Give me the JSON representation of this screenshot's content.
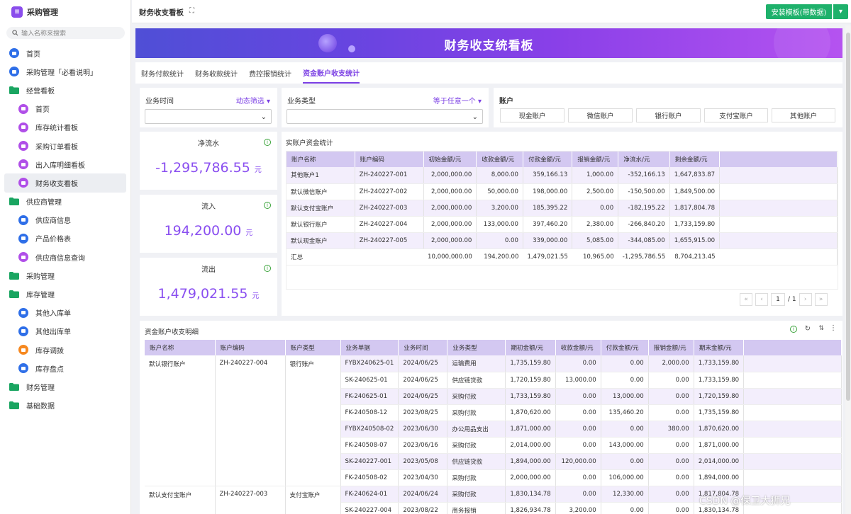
{
  "app": {
    "title": "采购管理"
  },
  "search": {
    "placeholder": "输入名称来搜索"
  },
  "nav": [
    {
      "label": "首页",
      "icon": "home-icon",
      "kind": "top"
    },
    {
      "label": "采购管理「必看说明」",
      "icon": "doc-icon",
      "kind": "top"
    },
    {
      "label": "经营看板",
      "icon": "folder-icon",
      "kind": "folder"
    },
    {
      "label": "首页",
      "icon": "dashboard-icon",
      "kind": "sub"
    },
    {
      "label": "库存统计看板",
      "icon": "dashboard-icon",
      "kind": "sub"
    },
    {
      "label": "采购订单看板",
      "icon": "dashboard-icon",
      "kind": "sub"
    },
    {
      "label": "出入库明细看板",
      "icon": "dashboard-icon",
      "kind": "sub"
    },
    {
      "label": "财务收支看板",
      "icon": "dashboard-icon",
      "kind": "sub",
      "active": true
    },
    {
      "label": "供应商管理",
      "icon": "folder-icon",
      "kind": "folder"
    },
    {
      "label": "供应商信息",
      "icon": "user-icon",
      "kind": "sub"
    },
    {
      "label": "产品价格表",
      "icon": "doc-icon",
      "kind": "sub"
    },
    {
      "label": "供应商信息查询",
      "icon": "dashboard-icon",
      "kind": "sub"
    },
    {
      "label": "采购管理",
      "icon": "folder-icon",
      "kind": "folder"
    },
    {
      "label": "库存管理",
      "icon": "folder-icon",
      "kind": "folder"
    },
    {
      "label": "其他入库单",
      "icon": "doc-icon",
      "kind": "sub"
    },
    {
      "label": "其他出库单",
      "icon": "doc-icon",
      "kind": "sub"
    },
    {
      "label": "库存调拨",
      "icon": "transfer-icon",
      "kind": "sub"
    },
    {
      "label": "库存盘点",
      "icon": "doc-icon",
      "kind": "sub"
    },
    {
      "label": "财务管理",
      "icon": "folder-icon",
      "kind": "folder"
    },
    {
      "label": "基础数据",
      "icon": "folder-icon",
      "kind": "folder"
    }
  ],
  "topbar": {
    "title": "财务收支看板",
    "install_label": "安装模板(带数据)"
  },
  "banner": {
    "title": "财务收支统看板"
  },
  "tabs": [
    "财务付款统计",
    "财务收款统计",
    "费控报销统计",
    "资金账户收支统计"
  ],
  "filters": {
    "time_label": "业务时间",
    "time_mode": "动态筛选",
    "type_label": "业务类型",
    "type_mode": "等于任意一个",
    "account_label": "账户",
    "account_buttons": [
      "现金账户",
      "微信账户",
      "银行账户",
      "支付宝账户",
      "其他账户"
    ]
  },
  "stats": [
    {
      "label": "净流水",
      "value": "-1,295,786.55",
      "unit": "元"
    },
    {
      "label": "流入",
      "value": "194,200.00",
      "unit": "元"
    },
    {
      "label": "流出",
      "value": "1,479,021.55",
      "unit": "元"
    }
  ],
  "summary": {
    "title": "实账户资金统计",
    "headers": [
      "账户名称",
      "账户编码",
      "初始金额/元",
      "收款金额/元",
      "付款金额/元",
      "报销金额/元",
      "净流水/元",
      "剩余金额/元"
    ],
    "rows": [
      [
        "其他账户1",
        "ZH-240227-001",
        "2,000,000.00",
        "8,000.00",
        "359,166.13",
        "1,000.00",
        "-352,166.13",
        "1,647,833.87"
      ],
      [
        "默认微信账户",
        "ZH-240227-002",
        "2,000,000.00",
        "50,000.00",
        "198,000.00",
        "2,500.00",
        "-150,500.00",
        "1,849,500.00"
      ],
      [
        "默认支付宝账户",
        "ZH-240227-003",
        "2,000,000.00",
        "3,200.00",
        "185,395.22",
        "0.00",
        "-182,195.22",
        "1,817,804.78"
      ],
      [
        "默认银行账户",
        "ZH-240227-004",
        "2,000,000.00",
        "133,000.00",
        "397,460.20",
        "2,380.00",
        "-266,840.20",
        "1,733,159.80"
      ],
      [
        "默认现金账户",
        "ZH-240227-005",
        "2,000,000.00",
        "0.00",
        "339,000.00",
        "5,085.00",
        "-344,085.00",
        "1,655,915.00"
      ],
      [
        "汇总",
        "",
        "10,000,000.00",
        "194,200.00",
        "1,479,021.55",
        "10,965.00",
        "-1,295,786.55",
        "8,704,213.45"
      ]
    ],
    "pager": {
      "page": "1",
      "total": "/ 1"
    }
  },
  "detail": {
    "title": "资金账户收支明细",
    "headers": [
      "账户名称",
      "账户编码",
      "账户类型",
      "业务单据",
      "业务时间",
      "业务类型",
      "期初金额/元",
      "收款金额/元",
      "付款金额/元",
      "报销金额/元",
      "期末金额/元"
    ],
    "rows": [
      [
        "默认银行账户",
        "ZH-240227-004",
        "银行账户",
        "FYBX240625-01",
        "2024/06/25",
        "运输费用",
        "1,735,159.80",
        "0.00",
        "0.00",
        "2,000.00",
        "1,733,159.80"
      ],
      [
        "",
        "",
        "",
        "SK-240625-01",
        "2024/06/25",
        "供应链贷款",
        "1,720,159.80",
        "13,000.00",
        "0.00",
        "0.00",
        "1,733,159.80"
      ],
      [
        "",
        "",
        "",
        "FK-240625-01",
        "2024/06/25",
        "采购付款",
        "1,733,159.80",
        "0.00",
        "13,000.00",
        "0.00",
        "1,720,159.80"
      ],
      [
        "",
        "",
        "",
        "FK-240508-12",
        "2023/08/25",
        "采购付款",
        "1,870,620.00",
        "0.00",
        "135,460.20",
        "0.00",
        "1,735,159.80"
      ],
      [
        "",
        "",
        "",
        "FYBX240508-02",
        "2023/06/30",
        "办公用品支出",
        "1,871,000.00",
        "0.00",
        "0.00",
        "380.00",
        "1,870,620.00"
      ],
      [
        "",
        "",
        "",
        "FK-240508-07",
        "2023/06/16",
        "采购付款",
        "2,014,000.00",
        "0.00",
        "143,000.00",
        "0.00",
        "1,871,000.00"
      ],
      [
        "",
        "",
        "",
        "SK-240227-001",
        "2023/05/08",
        "供应链贷款",
        "1,894,000.00",
        "120,000.00",
        "0.00",
        "0.00",
        "2,014,000.00"
      ],
      [
        "",
        "",
        "",
        "FK-240508-02",
        "2023/04/30",
        "采购付款",
        "2,000,000.00",
        "0.00",
        "106,000.00",
        "0.00",
        "1,894,000.00"
      ],
      [
        "默认支付宝账户",
        "ZH-240227-003",
        "支付宝账户",
        "FK-240624-01",
        "2024/06/24",
        "采购付款",
        "1,830,134.78",
        "0.00",
        "12,330.00",
        "0.00",
        "1,817,804.78"
      ],
      [
        "",
        "",
        "",
        "SK-240227-004",
        "2023/08/22",
        "商务报销",
        "1,826,934.78",
        "3,200.00",
        "0.00",
        "0.00",
        "1,830,134.78"
      ]
    ]
  },
  "watermark": "CSDN @保卫大狮兄",
  "colors": {
    "accent": "#7b3fe4",
    "header": "#d3c8f1",
    "install": "#1eb16b"
  }
}
